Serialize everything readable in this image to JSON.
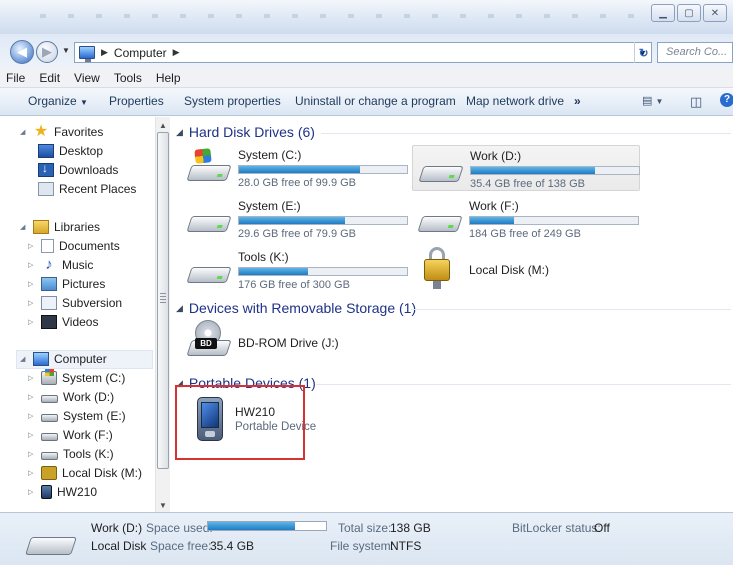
{
  "window": {
    "controls": [
      "minimize",
      "maximize",
      "close"
    ]
  },
  "address": {
    "location": "Computer",
    "search_placeholder": "Search Co..."
  },
  "menu": [
    "File",
    "Edit",
    "View",
    "Tools",
    "Help"
  ],
  "commands": {
    "organize": "Organize",
    "properties": "Properties",
    "system_properties": "System properties",
    "uninstall": "Uninstall or change a program",
    "map_network": "Map network drive",
    "more": "»"
  },
  "sidebar": {
    "favorites": {
      "label": "Favorites",
      "items": [
        "Desktop",
        "Downloads",
        "Recent Places"
      ]
    },
    "libraries": {
      "label": "Libraries",
      "items": [
        "Documents",
        "Music",
        "Pictures",
        "Subversion",
        "Videos"
      ]
    },
    "computer": {
      "label": "Computer",
      "items": [
        "System (C:)",
        "Work (D:)",
        "System (E:)",
        "Work (F:)",
        "Tools (K:)",
        "Local Disk (M:)",
        "HW210"
      ]
    }
  },
  "groups": {
    "hdd": "Hard Disk Drives (6)",
    "removable": "Devices with Removable Storage (1)",
    "portable": "Portable Devices (1)"
  },
  "drives": [
    {
      "name": "System (C:)",
      "free": "28.0 GB free of 99.9 GB",
      "used_fraction": 0.72
    },
    {
      "name": "Work (D:)",
      "free": "35.4 GB free of 138 GB",
      "used_fraction": 0.74
    },
    {
      "name": "System (E:)",
      "free": "29.6 GB free of 79.9 GB",
      "used_fraction": 0.63
    },
    {
      "name": "Work (F:)",
      "free": "184 GB free of 249 GB",
      "used_fraction": 0.26
    },
    {
      "name": "Tools (K:)",
      "free": "176 GB free of 300 GB",
      "used_fraction": 0.41
    },
    {
      "name": "Local Disk (M:)"
    }
  ],
  "removable": [
    {
      "name": "BD-ROM Drive (J:)",
      "badge": "BD"
    }
  ],
  "portable": [
    {
      "name": "HW210",
      "type": "Portable Device"
    }
  ],
  "details": {
    "name": "Work (D:)",
    "type": "Local Disk",
    "space_used_label": "Space used:",
    "space_free_label": "Space free:",
    "space_free": "35.4 GB",
    "used_fraction": 0.74,
    "total_size_label": "Total size:",
    "total_size": "138 GB",
    "file_system_label": "File system:",
    "file_system": "NTFS",
    "bitlocker_label": "BitLocker status:",
    "bitlocker": "Off"
  },
  "colors": {
    "highlight_box": "#d63232",
    "usage_bar": "#1f7cc2",
    "group_heading": "#1e3287"
  }
}
